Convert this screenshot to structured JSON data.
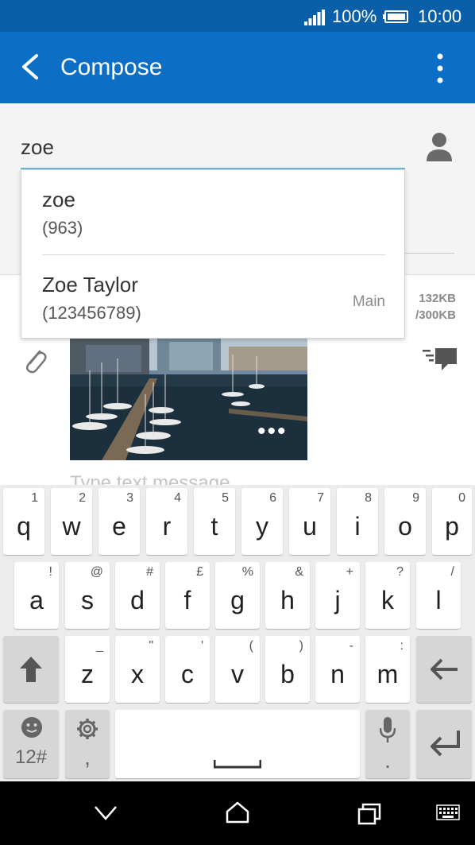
{
  "status_bar": {
    "battery_percent": "100%",
    "time": "10:00",
    "signal_icon": "signal-icon",
    "battery_icon": "battery-icon"
  },
  "app_bar": {
    "title": "Compose",
    "back_icon": "back-arrow-icon",
    "menu_icon": "more-vert-icon"
  },
  "recipient": {
    "input_value": "zoe",
    "contact_icon": "contact-person-icon"
  },
  "suggestions": [
    {
      "name": "zoe",
      "number": "(963)",
      "type": ""
    },
    {
      "name": "Zoe Taylor",
      "number": "(123456789)",
      "type": "Main"
    }
  ],
  "message": {
    "size_used": "132KB",
    "size_limit": "/300KB",
    "placeholder": "Type text message",
    "attachment_more": "•••"
  },
  "keyboard": {
    "row1": [
      {
        "key": "q",
        "hint": "1"
      },
      {
        "key": "w",
        "hint": "2"
      },
      {
        "key": "e",
        "hint": "3"
      },
      {
        "key": "r",
        "hint": "4"
      },
      {
        "key": "t",
        "hint": "5"
      },
      {
        "key": "y",
        "hint": "6"
      },
      {
        "key": "u",
        "hint": "7"
      },
      {
        "key": "i",
        "hint": "8"
      },
      {
        "key": "o",
        "hint": "9"
      },
      {
        "key": "p",
        "hint": "0"
      }
    ],
    "row2": [
      {
        "key": "a",
        "hint": "!"
      },
      {
        "key": "s",
        "hint": "@"
      },
      {
        "key": "d",
        "hint": "#"
      },
      {
        "key": "f",
        "hint": "£"
      },
      {
        "key": "g",
        "hint": "%"
      },
      {
        "key": "h",
        "hint": "&"
      },
      {
        "key": "j",
        "hint": "+"
      },
      {
        "key": "k",
        "hint": "?"
      },
      {
        "key": "l",
        "hint": "/"
      }
    ],
    "row3": [
      {
        "key": "z",
        "hint": "_"
      },
      {
        "key": "x",
        "hint": "\""
      },
      {
        "key": "c",
        "hint": "'"
      },
      {
        "key": "v",
        "hint": "("
      },
      {
        "key": "b",
        "hint": ")"
      },
      {
        "key": "n",
        "hint": "-"
      },
      {
        "key": "m",
        "hint": ":"
      }
    ],
    "symbols_label": "12#",
    "comma_label": ",",
    "period_label": "."
  },
  "nav_bar": {
    "back_icon": "nav-back-icon",
    "home_icon": "nav-home-icon",
    "recents_icon": "nav-recents-icon",
    "keyboard_icon": "keyboard-icon"
  }
}
